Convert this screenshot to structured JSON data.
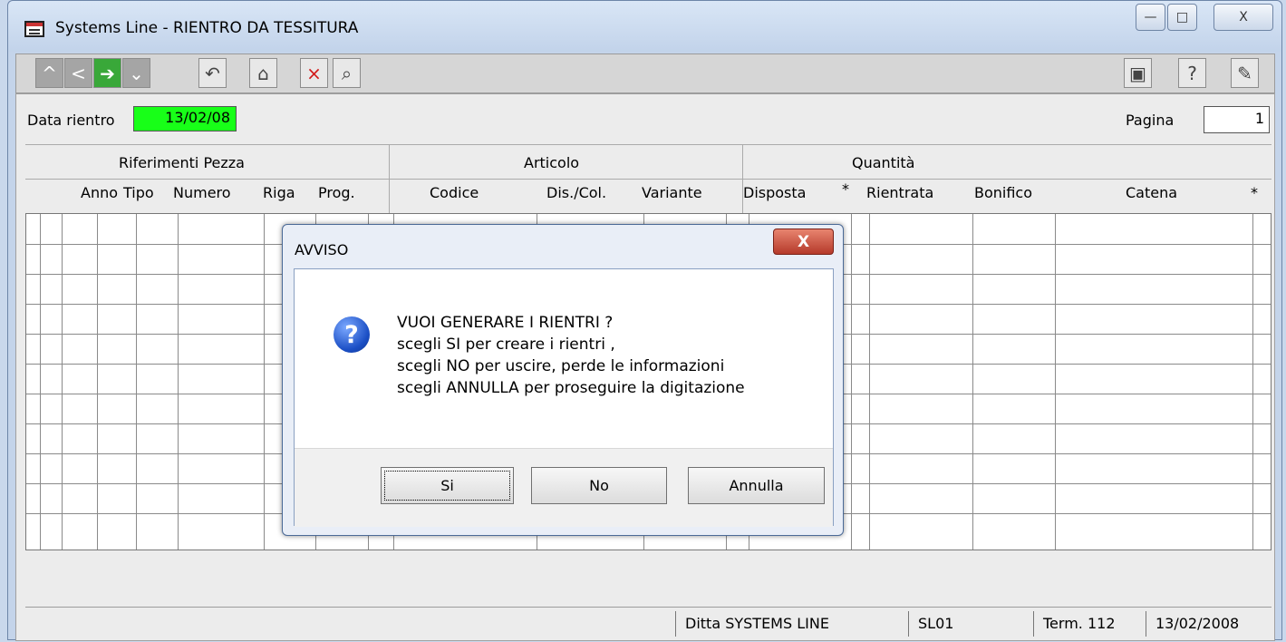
{
  "window": {
    "title": "Systems Line - RIENTRO DA TESSITURA",
    "controls": {
      "minimize": "—",
      "maximize": "□",
      "close": "X"
    }
  },
  "toolbar": {
    "first": "^",
    "prev": "<",
    "next": "➔",
    "last": "⌄",
    "undo": "↶",
    "home": "⌂",
    "delete": "×",
    "search": "⌕",
    "copy": "▣",
    "help": "?",
    "exit": "✎"
  },
  "form": {
    "date_label": "Data rientro",
    "date_value": "13/02/08",
    "page_label": "Pagina",
    "page_value": "1"
  },
  "table": {
    "groups": [
      "Riferimenti Pezza",
      "Articolo",
      "Quantità"
    ],
    "columns": [
      "Anno",
      "Tipo",
      "Numero",
      "Riga",
      "Prog.",
      "Codice",
      "Dis./Col.",
      "Variante",
      "Disposta",
      "*",
      "Rientrata",
      "Bonifico",
      "Catena",
      "*"
    ]
  },
  "status": {
    "company": "Ditta SYSTEMS LINE",
    "code": "SL01",
    "terminal": "Term. 112",
    "date": "13/02/2008"
  },
  "dialog": {
    "title": "AVVISO",
    "close": "X",
    "icon": "?",
    "message": [
      "VUOI GENERARE I RIENTRI ?",
      "scegli SI per creare i rientri   ,",
      "scegli NO per uscire, perde le informazioni",
      "scegli ANNULLA per proseguire la digitazione"
    ],
    "buttons": {
      "yes": "Si",
      "no": "No",
      "cancel": "Annulla"
    }
  }
}
